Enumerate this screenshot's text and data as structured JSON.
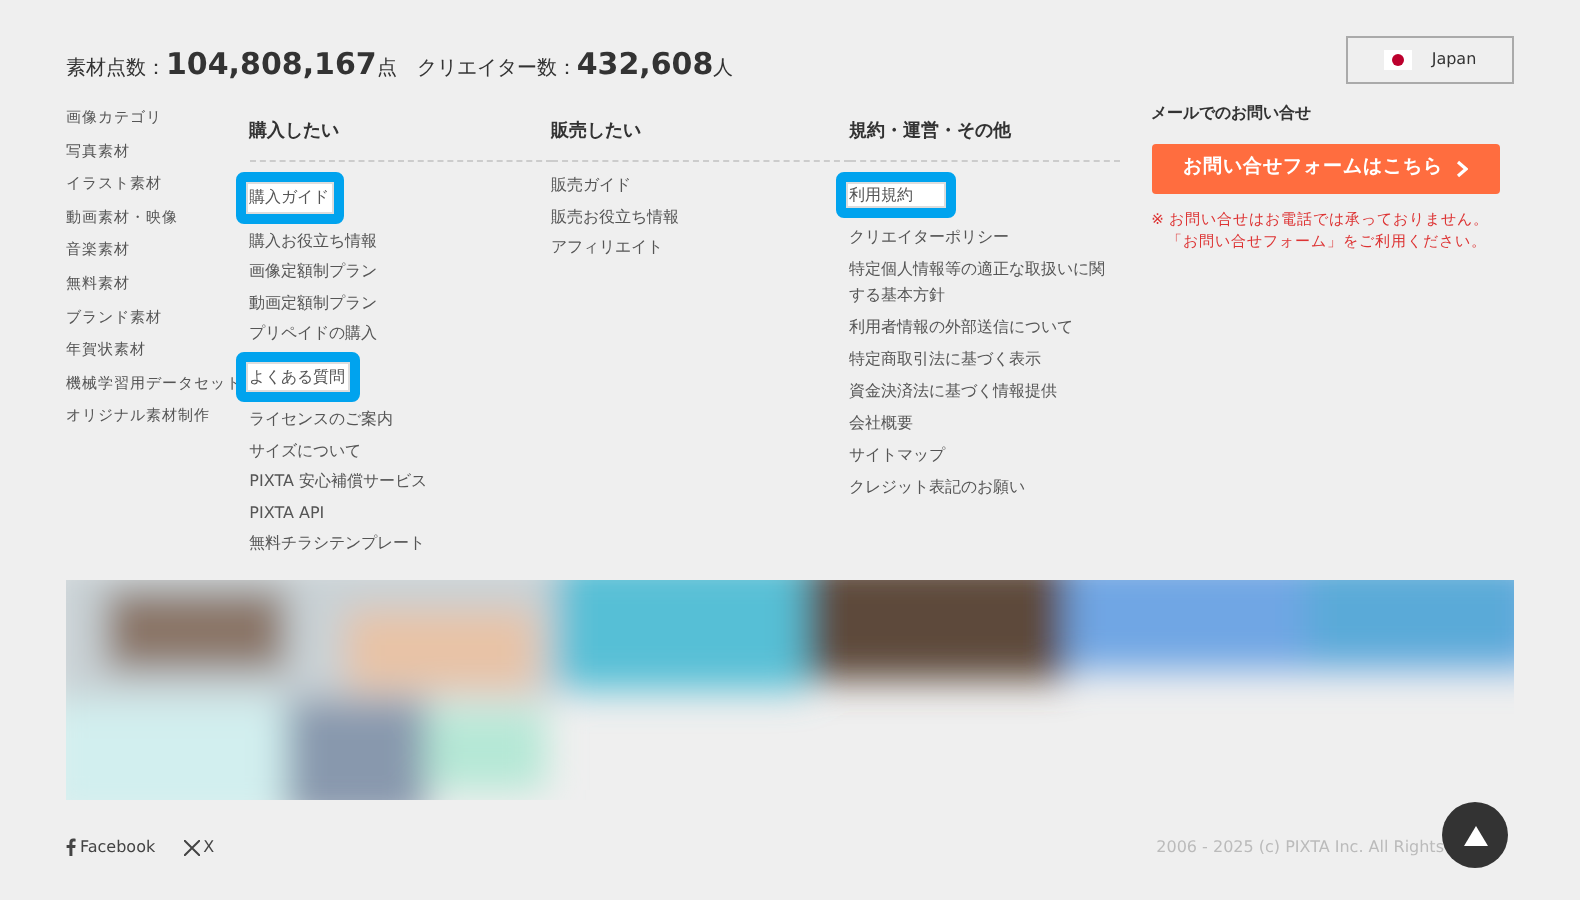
{
  "stats": {
    "materials_label": "素材点数：",
    "materials_value": "104,808,167",
    "materials_unit": "点",
    "creators_label": "クリエイター数：",
    "creators_value": "432,608",
    "creators_unit": "人"
  },
  "region_button": {
    "label": "Japan"
  },
  "categories": [
    "画像カテゴリ",
    "写真素材",
    "イラスト素材",
    "動画素材・映像",
    "音楽素材",
    "無料素材",
    "ブランド素材",
    "年賀状素材",
    "機械学習用データセット",
    "オリジナル素材制作"
  ],
  "columns": [
    {
      "heading": "購入したい",
      "links": [
        {
          "label": "購入ガイド",
          "highlighted": true
        },
        {
          "label": "購入お役立ち情報",
          "highlighted": false
        },
        {
          "label": "画像定額制プラン",
          "highlighted": false
        },
        {
          "label": "動画定額制プラン",
          "highlighted": false
        },
        {
          "label": "プリペイドの購入",
          "highlighted": false
        },
        {
          "label": "よくある質問",
          "highlighted": true
        },
        {
          "label": "ライセンスのご案内",
          "highlighted": false
        },
        {
          "label": "サイズについて",
          "highlighted": false
        },
        {
          "label": "PIXTA 安心補償サービス",
          "highlighted": false
        },
        {
          "label": "PIXTA API",
          "highlighted": false
        },
        {
          "label": "無料チラシテンプレート",
          "highlighted": false
        }
      ]
    },
    {
      "heading": "販売したい",
      "links": [
        {
          "label": "販売ガイド",
          "highlighted": false
        },
        {
          "label": "販売お役立ち情報",
          "highlighted": false
        },
        {
          "label": "アフィリエイト",
          "highlighted": false
        }
      ]
    },
    {
      "heading": "規約・運営・その他",
      "links": [
        {
          "label": "利用規約",
          "highlighted": true
        },
        {
          "label": "クリエイターポリシー",
          "highlighted": false
        },
        {
          "label": "特定個人情報等の適正な取扱いに関する基本方針",
          "highlighted": false
        },
        {
          "label": "利用者情報の外部送信について",
          "highlighted": false
        },
        {
          "label": "特定商取引法に基づく表示",
          "highlighted": false
        },
        {
          "label": "資金決済法に基づく情報提供",
          "highlighted": false
        },
        {
          "label": "会社概要",
          "highlighted": false
        },
        {
          "label": "サイトマップ",
          "highlighted": false
        },
        {
          "label": "クレジット表記のお願い",
          "highlighted": false
        }
      ]
    }
  ],
  "contact": {
    "heading": "メールでのお問い合せ",
    "button": "お問い合せフォームはこちら",
    "notes": [
      "※ お問い合せはお電話では承っておりません。",
      "「お問い合せフォーム」をご利用ください。"
    ]
  },
  "gallery": {
    "kind": "picture"
  },
  "social": [
    {
      "kind": "facebook",
      "label": "Facebook"
    },
    {
      "kind": "x",
      "label": "X"
    }
  ],
  "copyright": "2006 - 2025 (c) PIXTA Inc. All Rights"
}
